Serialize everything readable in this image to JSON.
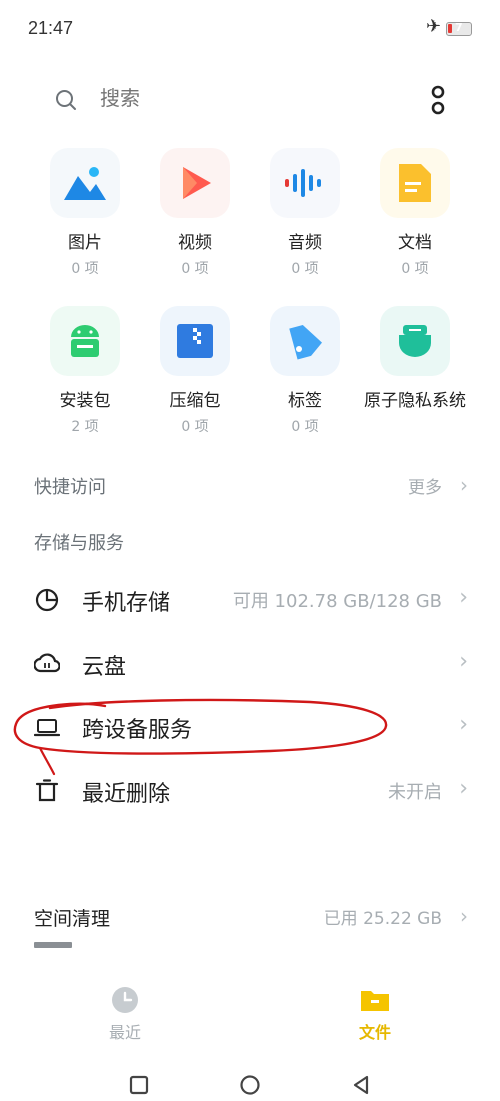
{
  "status_bar": {
    "time": "21:47",
    "battery": "7",
    "airplane_icon": "airplane-icon"
  },
  "search": {
    "placeholder": "搜索"
  },
  "categories": [
    {
      "label": "图片",
      "count": "0 项",
      "icon": "image-icon"
    },
    {
      "label": "视频",
      "count": "0 项",
      "icon": "video-icon"
    },
    {
      "label": "音频",
      "count": "0 项",
      "icon": "audio-icon"
    },
    {
      "label": "文档",
      "count": "0 项",
      "icon": "document-icon"
    },
    {
      "label": "安装包",
      "count": "2 项",
      "icon": "android-package-icon"
    },
    {
      "label": "压缩包",
      "count": "0 项",
      "icon": "archive-icon"
    },
    {
      "label": "标签",
      "count": "0 项",
      "icon": "tag-icon"
    },
    {
      "label": "原子隐私系统",
      "count": "",
      "icon": "privacy-system-icon"
    }
  ],
  "quick_access": {
    "title": "快捷访问",
    "more": "更多"
  },
  "storage": {
    "title": "存储与服务",
    "items": [
      {
        "label": "手机存储",
        "right": "可用 102.78 GB/128 GB",
        "icon": "pie-chart-icon"
      },
      {
        "label": "云盘",
        "right": "",
        "icon": "cloud-icon"
      },
      {
        "label": "跨设备服务",
        "right": "",
        "icon": "laptop-icon"
      },
      {
        "label": "最近删除",
        "right": "未开启",
        "icon": "trash-icon"
      }
    ]
  },
  "cleanup": {
    "title": "空间清理",
    "used": "已用 25.22 GB"
  },
  "bottom_nav": {
    "recent": "最近",
    "files": "文件"
  },
  "colors": {
    "accent": "#f5c400",
    "annotation_red": "#d01818",
    "muted_text": "#a7adb2"
  }
}
